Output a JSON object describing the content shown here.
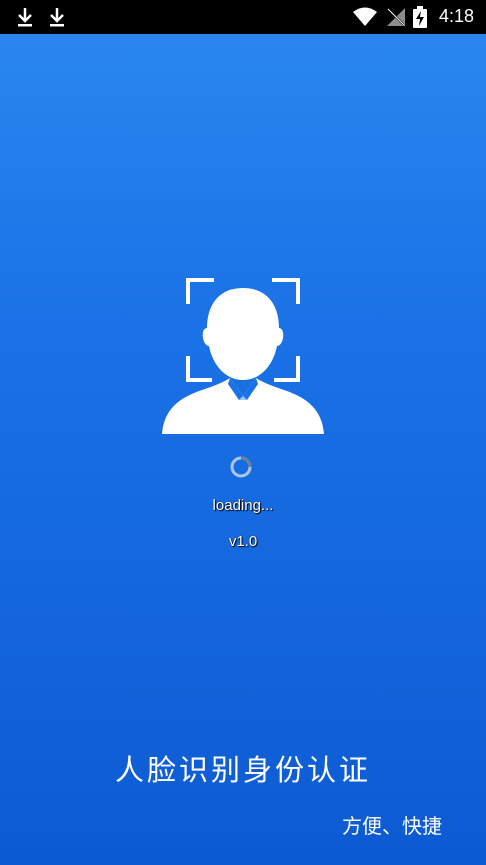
{
  "status_bar": {
    "time": "4:18",
    "icons": [
      "download-icon",
      "download-icon",
      "wifi-icon",
      "no-signal-icon",
      "battery-charging-icon"
    ]
  },
  "splash": {
    "loading_text": "loading...",
    "version_text": "v1.0",
    "title": "人脸识别身份认证",
    "subtitle": "方便、快捷"
  },
  "colors": {
    "background_top": "#2a86ef",
    "background_bottom": "#0c5ad2",
    "text": "#ffffff",
    "status_bar": "#000000"
  }
}
